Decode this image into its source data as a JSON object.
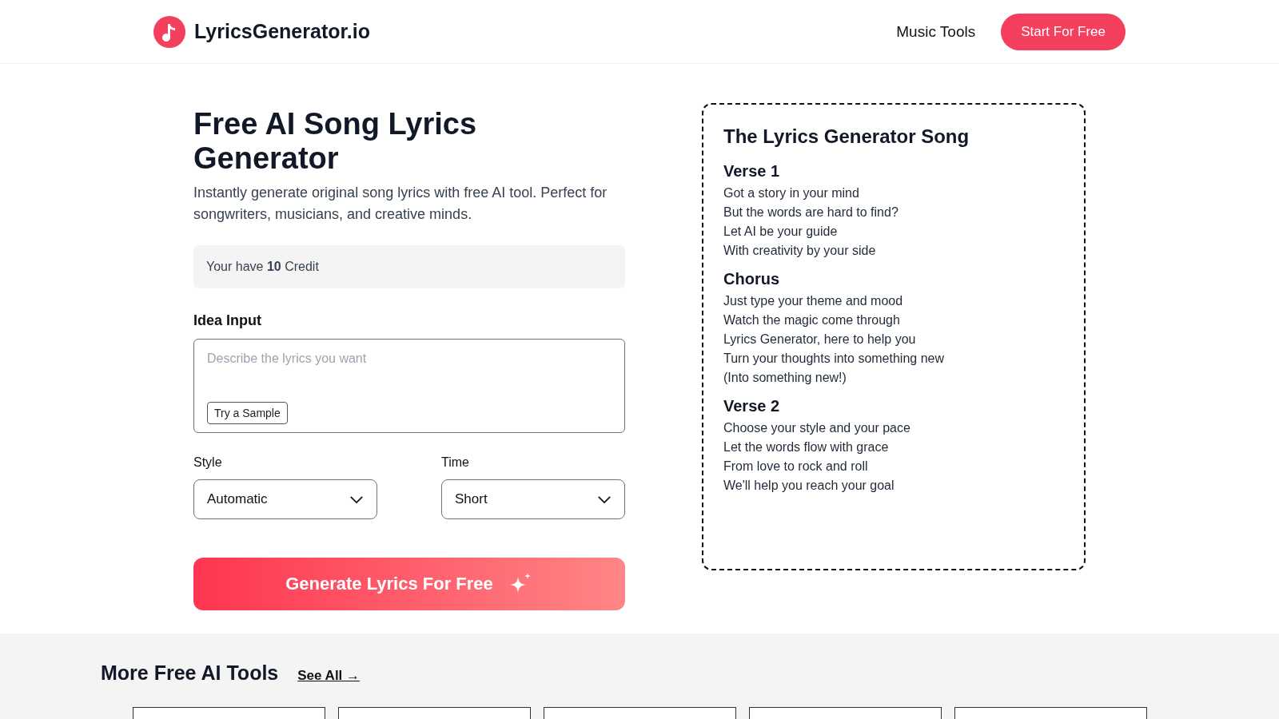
{
  "header": {
    "brand": "LyricsGenerator.io",
    "nav": [
      "Music Tools"
    ],
    "cta": "Start For Free"
  },
  "hero": {
    "title": "Free AI Song Lyrics Generator",
    "subtitle": "Instantly generate original song lyrics with free AI tool. Perfect for songwriters, musicians, and creative minds.",
    "credits": "Your have **10** Credit"
  },
  "idea": {
    "label": "Idea Input",
    "placeholder": "Describe the lyrics you want",
    "sample_button": "Try a Sample"
  },
  "selects": [
    {
      "label": "Style",
      "value": "Automatic"
    },
    {
      "label": "Time",
      "value": "Short"
    }
  ],
  "generate_button": "Generate Lyrics For Free",
  "song": {
    "title": "The Lyrics Generator Song",
    "sections": [
      {
        "heading": "Verse 1",
        "lines": [
          "Got a story in your mind",
          "But the words are hard to find?",
          "Let AI be your guide",
          "With creativity by your side"
        ]
      },
      {
        "heading": "Chorus",
        "lines": [
          "Just type your theme and mood",
          "Watch the magic come through",
          "Lyrics Generator, here to help you",
          "Turn your thoughts into something new",
          "(Into something new!)"
        ]
      },
      {
        "heading": "Verse 2",
        "lines": [
          "Choose your style and your pace",
          "Let the words flow with grace",
          "From love to rock and roll",
          "We'll help you reach your goal"
        ]
      }
    ]
  },
  "more_tools": {
    "title": "More Free AI Tools",
    "link": "See All →"
  }
}
